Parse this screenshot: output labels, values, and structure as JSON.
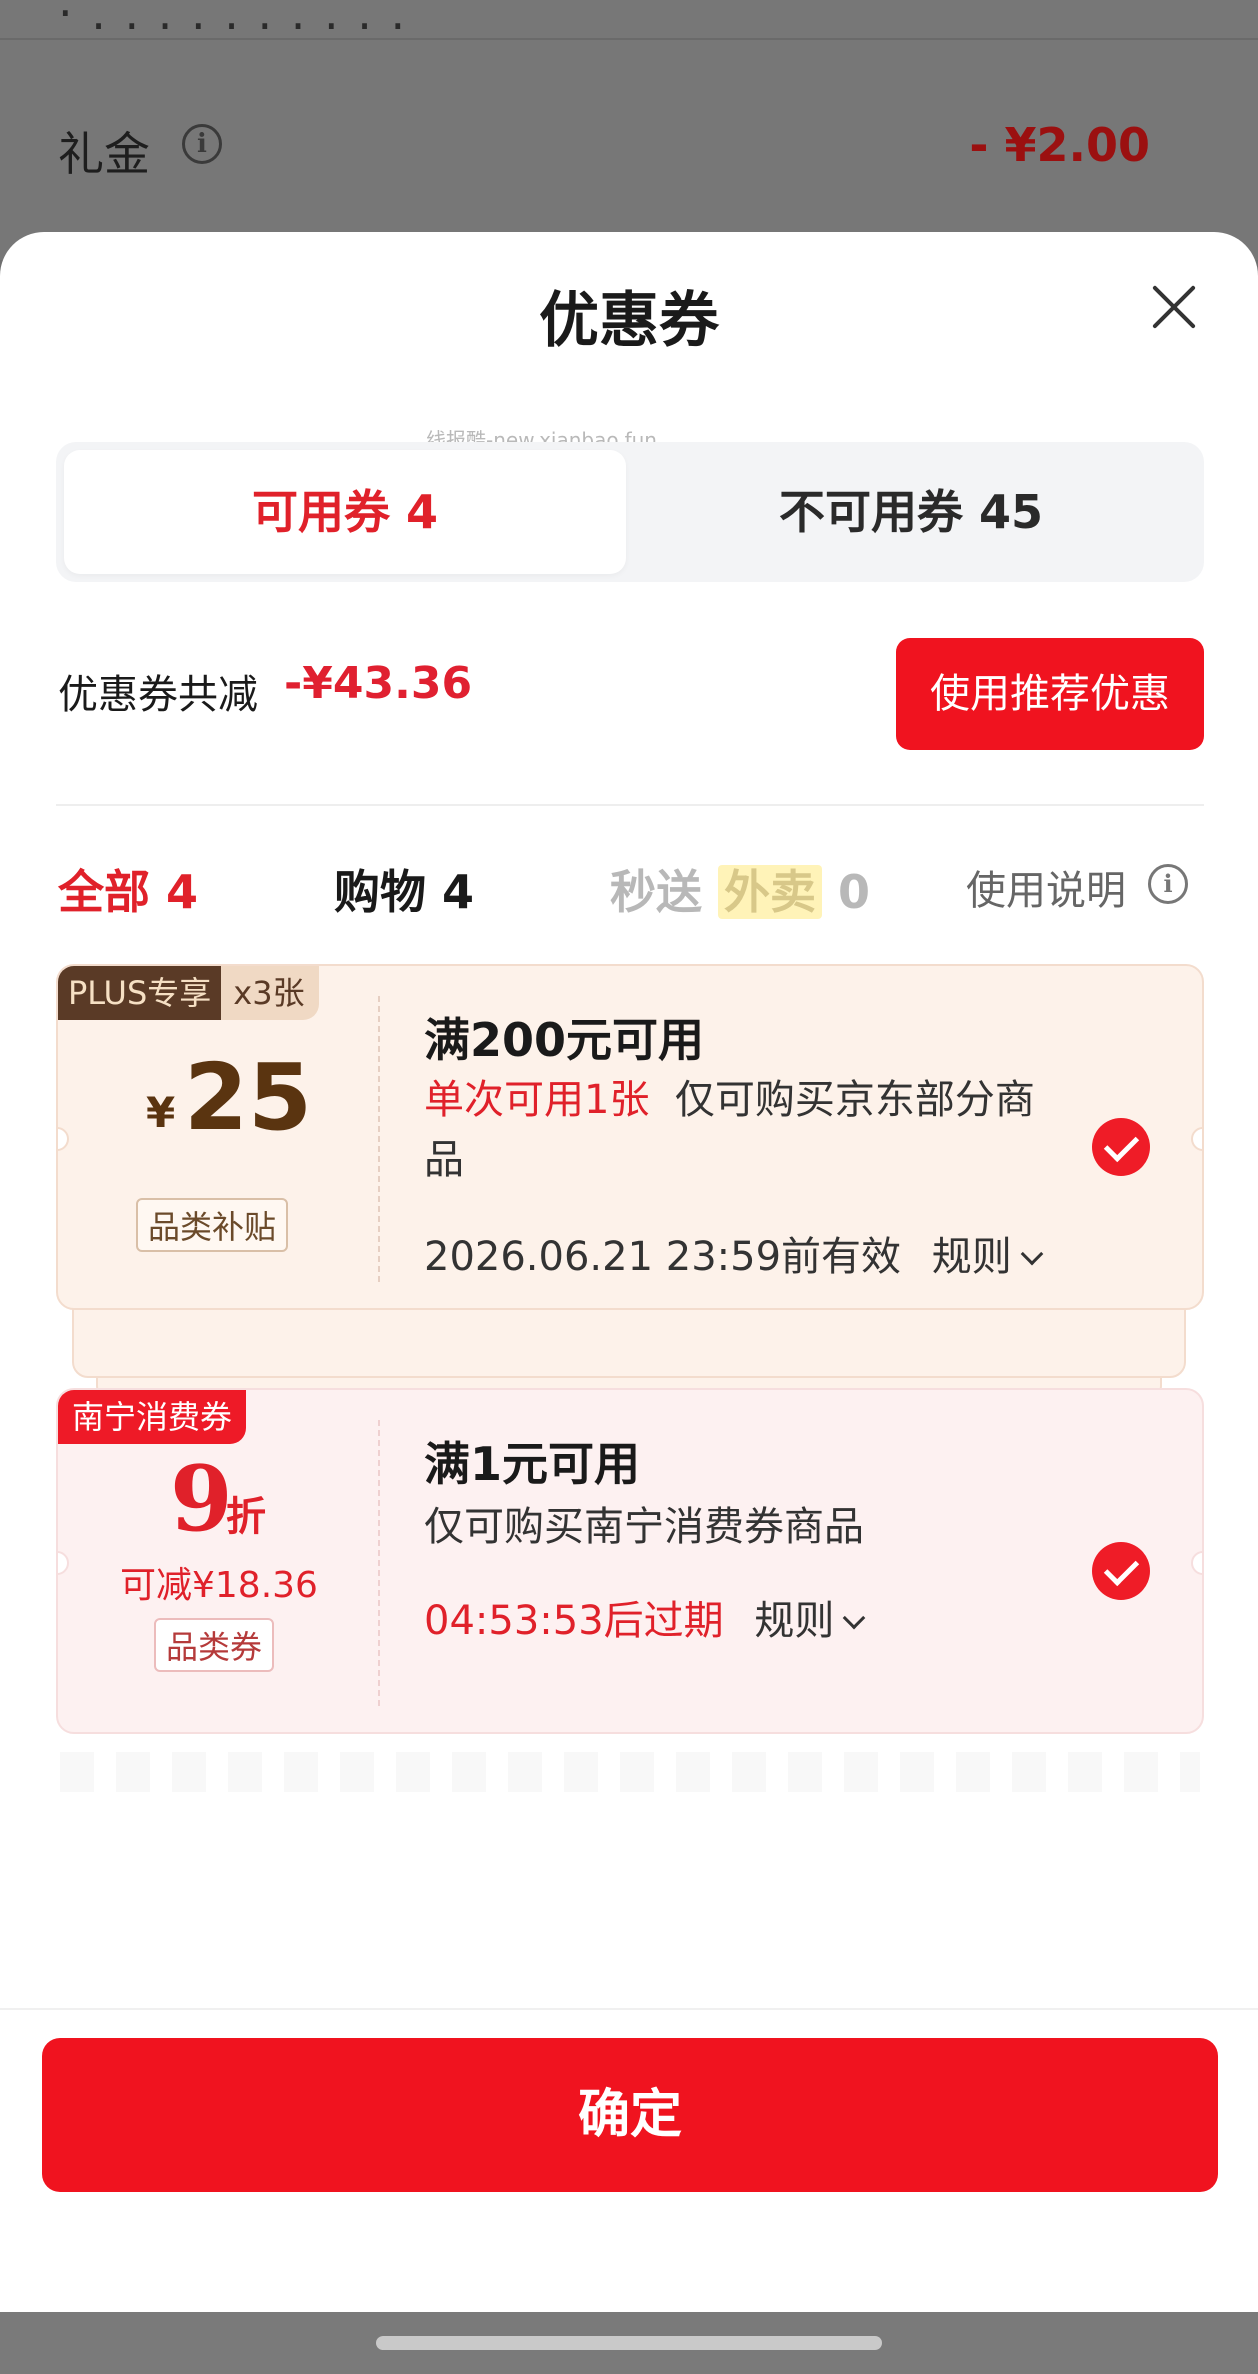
{
  "background": {
    "top_text": "·  . . . . . . . . . .",
    "gift_label": "礼金",
    "gift_amount": "- ¥2.00"
  },
  "sheet": {
    "title": "优惠券",
    "watermark": "线报酷-new.xianbao.fun",
    "tabs": [
      {
        "label": "可用券 4",
        "active": true
      },
      {
        "label": "不可用券 45",
        "active": false
      }
    ],
    "total_label": "优惠券共减",
    "total_amount": "-¥43.36",
    "recommend_button": "使用推荐优惠",
    "filters": {
      "all": "全部 4",
      "shopping": "购物 4",
      "fast_prefix": "秒送",
      "fast_tag": "外卖",
      "fast_count": "0",
      "usage": "使用说明"
    },
    "coupons": [
      {
        "badge": "PLUS专享",
        "count": "x3张",
        "currency": "¥",
        "value": "25",
        "category": "品类补贴",
        "condition": "满200元可用",
        "limit": "单次可用1张",
        "scope": "仅可购买京东部分商品",
        "valid": "2026.06.21 23:59前有效",
        "rule": "规则",
        "checked": true
      },
      {
        "badge": "南宁消费券",
        "value": "9",
        "unit": "折",
        "reduce": "可减¥18.36",
        "category": "品类券",
        "condition": "满1元可用",
        "scope": "仅可购买南宁消费券商品",
        "expire": "04:53:53后过期",
        "rule": "规则",
        "checked": true
      }
    ],
    "confirm_button": "确定"
  },
  "colors": {
    "accent_red": "#f0131f",
    "text_red": "#e0212a",
    "plus_brown": "#5a3a26"
  }
}
